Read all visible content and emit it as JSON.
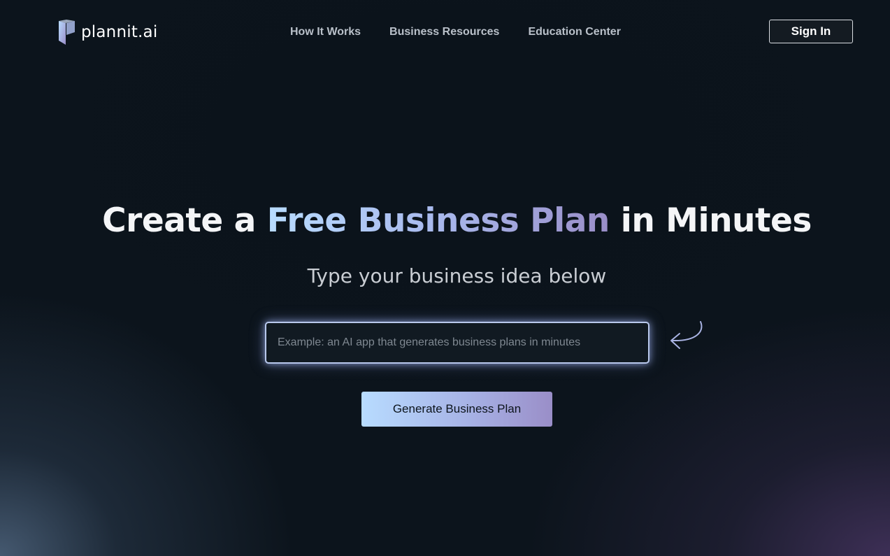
{
  "brand": {
    "name": "plannit.ai",
    "accent_light": "#b8dcff",
    "accent_purple": "#9a8ec8",
    "background": "#0c141c"
  },
  "nav": {
    "items": [
      {
        "label": "How It Works"
      },
      {
        "label": "Business Resources"
      },
      {
        "label": "Education Center"
      }
    ],
    "sign_in_label": "Sign In"
  },
  "hero": {
    "title_prefix": "Create a ",
    "title_highlight": "Free Business Plan",
    "title_suffix": " in Minutes",
    "subtitle": "Type your business idea below",
    "input_placeholder": "Example: an AI app that generates business plans in minutes",
    "input_value": "",
    "generate_label": "Generate Business Plan",
    "arrow_icon": "curved-arrow-left-icon"
  }
}
